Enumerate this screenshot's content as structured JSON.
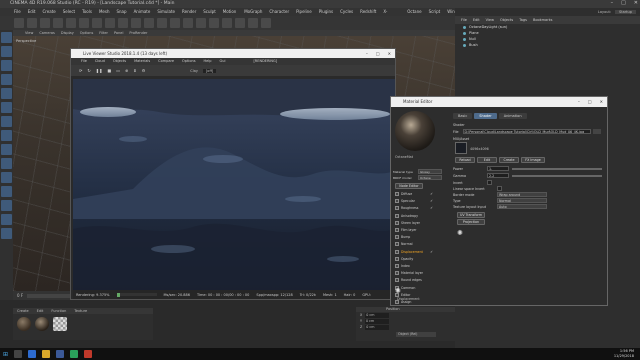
{
  "app": {
    "title": "CINEMA 4D R19.068 Studio (RC - R19) - [Landscape Tutorial.c4d *] - Main",
    "menu": [
      "File",
      "Edit",
      "Create",
      "Select",
      "Tools",
      "Mesh",
      "Snap",
      "Animate",
      "Simulate",
      "Render",
      "Sculpt",
      "Motion Tracker",
      "MoGraph",
      "Character",
      "Pipeline",
      "Plugins",
      "Cycles 4D",
      "Redshift",
      "X-Particles",
      "Octane",
      "Script",
      "Window",
      "Help"
    ],
    "layout_label": "Layout:",
    "layout_value": "Startup"
  },
  "object_manager": {
    "menu": [
      "File",
      "Edit",
      "View",
      "Objects",
      "Tags",
      "Bookmarks"
    ],
    "objects": [
      "OctaneDayLight (sun)",
      "Plane",
      "Null",
      "Bush"
    ]
  },
  "viewport": {
    "menu": [
      "View",
      "Cameras",
      "Display",
      "Options",
      "Filter",
      "Panel",
      "ProRender"
    ],
    "label": "Perspective"
  },
  "live_viewer": {
    "title": "Live Viewer Studio 2018.1.4 (13 days left)",
    "menu": [
      "File",
      "Cloud",
      "Objects",
      "Materials",
      "Compare",
      "Options",
      "Help",
      "Gui"
    ],
    "toolbar_label": "[RENDERING]",
    "clay_label": "Clay",
    "clay_value": "[off]",
    "status": {
      "rendering": "Rendering: 9.375%",
      "ms_sec": "Ms/sec: 20.886",
      "time": "Time: 00 : 00 : 00/00 : 00 : 00",
      "spp": "Spp/maxspp: 12/128",
      "tri": "Tri: 0/22k",
      "mesh": "Mesh: 1",
      "hair": "Hair: 0",
      "gpu": "GPU:"
    },
    "progress": 0.094
  },
  "material_editor": {
    "title": "Material Editor",
    "material_name": "OctaneMat",
    "tabs": [
      "Basic",
      "Shader",
      "Animation"
    ],
    "active_tab": "Shader",
    "shader_label": "Shader",
    "file_label": "File",
    "file_path": "D:\\Personal\\Cloud\\Landscape Tutorial\\Cirt\\OLD_Mud\\OLD_Mud_06_4K.jpg",
    "mix_asset_label": "MIX/Asset",
    "image_size": "4096x4096",
    "buttons": [
      "Reload",
      "Edit",
      "Create",
      "FX Image"
    ],
    "power_label": "Power",
    "power_value": "1.",
    "gamma_label": "Gamma",
    "gamma_value": "2.2",
    "invert_label": "Invert",
    "linear_space_label": "Linear space Invert",
    "border_mode_label": "Border mode",
    "border_mode_value": "Wrap around",
    "type_label": "Type",
    "type_value": "Normal",
    "texture_layout_label": "Texture layout Input",
    "texture_layout_value": "Auto",
    "uv_transform_btn": "UV Transform",
    "projection_btn": "Projection",
    "material_type_label": "Material type",
    "material_type_value": "Glossy",
    "brdf_label": "BRDF model",
    "brdf_value": "Octane",
    "node_editor_btn": "Node Editor",
    "channels": [
      {
        "name": "Diffuse",
        "checked": true
      },
      {
        "name": "Specular",
        "checked": true
      },
      {
        "name": "Roughness",
        "checked": true
      },
      {
        "name": "Anisotropy",
        "checked": false
      },
      {
        "name": "Sheen layer",
        "checked": false
      },
      {
        "name": "Film layer",
        "checked": false
      },
      {
        "name": "Bump",
        "checked": false
      },
      {
        "name": "Normal",
        "checked": false
      },
      {
        "name": "Displacement",
        "checked": true
      },
      {
        "name": "Opacity",
        "checked": false
      },
      {
        "name": "Index",
        "checked": false
      },
      {
        "name": "Material layer",
        "checked": false
      },
      {
        "name": "Round edges",
        "checked": false
      },
      {
        "name": "Common",
        "checked": false
      },
      {
        "name": "Editor",
        "checked": false
      },
      {
        "name": "Assign",
        "checked": false
      }
    ],
    "selected_channel": "Displacement",
    "footer_label": "Displacement"
  },
  "materials": {
    "menu": [
      "Create",
      "Edit",
      "Function",
      "Texture"
    ],
    "items": [
      "Mud",
      "Rock",
      "Clay"
    ]
  },
  "coordinates": {
    "header": "Position",
    "rows": [
      {
        "axis": "X",
        "value": "0 cm"
      },
      {
        "axis": "Y",
        "value": "0 cm"
      },
      {
        "axis": "Z",
        "value": "0 cm"
      }
    ],
    "apply": "Object (Rel)"
  },
  "timeline": {
    "frame": "0 F",
    "end": "90 F"
  },
  "taskbar": {
    "time": "1:56 PM",
    "date": "11/29/2018"
  },
  "colors": {
    "accent": "#4e6b8c",
    "selected_channel": "#f5a623",
    "progress": "#66aa66"
  }
}
